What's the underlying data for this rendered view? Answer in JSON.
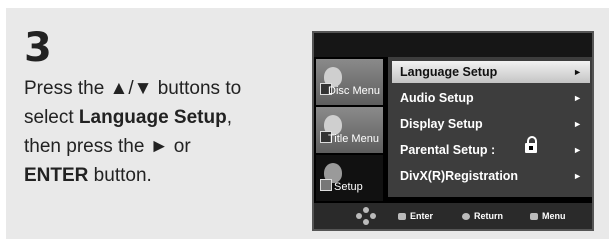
{
  "step": {
    "number": "3"
  },
  "instructions": {
    "line1_pre": "Press the ",
    "line1_arrows": "▲/▼",
    "line1_post": " buttons to",
    "line2_pre": "select ",
    "line2_bold": "Language Setup",
    "line2_post": ",",
    "line3_pre": "then press the ",
    "line3_arrow": "►",
    "line3_post": " or",
    "line4_bold": "ENTER",
    "line4_post": " button."
  },
  "screen": {
    "tabs": [
      {
        "label": "Disc Menu"
      },
      {
        "label": "Title Menu"
      },
      {
        "label": "Setup"
      }
    ],
    "menu": [
      {
        "label": "Language Setup",
        "arrow": "►"
      },
      {
        "label": "Audio Setup",
        "arrow": "►"
      },
      {
        "label": "Display Setup",
        "arrow": "►"
      },
      {
        "label": "Parental Setup :",
        "arrow": "►"
      },
      {
        "label": "DivX(R)Registration",
        "arrow": "►"
      }
    ],
    "bottom": {
      "enter": "Enter",
      "return": "Return",
      "menu": "Menu"
    }
  }
}
